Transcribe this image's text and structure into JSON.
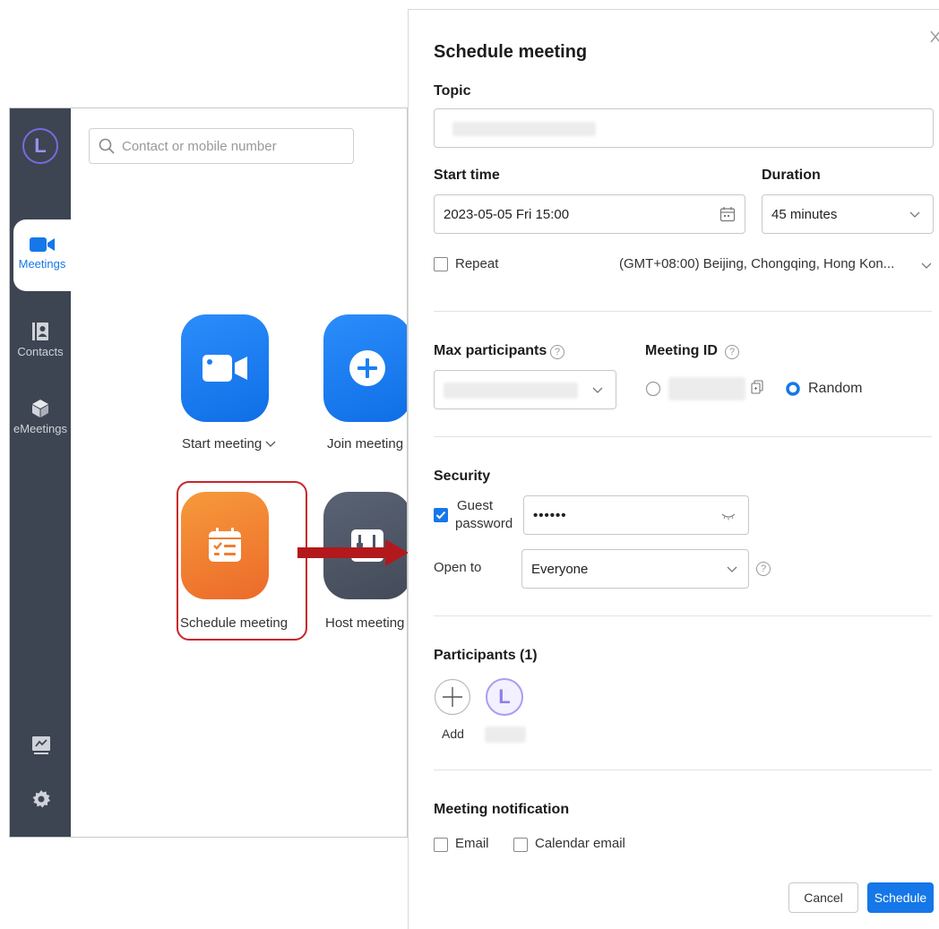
{
  "sidebar": {
    "avatar_initial": "L",
    "items": [
      {
        "label": "Meetings",
        "icon": "video-camera-icon"
      },
      {
        "label": "Contacts",
        "icon": "contact-card-icon"
      },
      {
        "label": "eMeetings",
        "icon": "cube-icon"
      }
    ],
    "bottom_icons": [
      "whiteboard-icon",
      "gear-icon"
    ]
  },
  "search": {
    "placeholder": "Contact or mobile number"
  },
  "tiles": [
    {
      "label": "Start meeting",
      "icon": "video-camera-icon",
      "color": "#1a7ef5"
    },
    {
      "label": "Join meeting",
      "icon": "plus-icon",
      "color": "#1a7ef5"
    },
    {
      "label": "Schedule meeting",
      "icon": "calendar-checklist-icon",
      "color": "#f07e30"
    },
    {
      "label": "Host meeting",
      "icon": "host-icon",
      "color": "#4c5565"
    }
  ],
  "dialog": {
    "title": "Schedule meeting",
    "close_icon": "close-icon",
    "topic": {
      "label": "Topic",
      "value": ""
    },
    "start_time": {
      "label": "Start time",
      "value": "2023-05-05 Fri 15:00"
    },
    "duration": {
      "label": "Duration",
      "value": "45 minutes"
    },
    "repeat": {
      "label": "Repeat",
      "checked": false
    },
    "timezone": "(GMT+08:00) Beijing, Chongqing, Hong Kon...",
    "max_participants": {
      "label": "Max participants",
      "value": ""
    },
    "meeting_id": {
      "label": "Meeting ID",
      "random_label": "Random",
      "selected": "Random"
    },
    "security": {
      "title": "Security",
      "guest_password_label_line1": "Guest",
      "guest_password_label_line2": "password",
      "guest_password_checked": true,
      "password_value": "••••••",
      "open_to_label": "Open to",
      "open_to_value": "Everyone"
    },
    "participants": {
      "title": "Participants (1)",
      "add_label": "Add",
      "avatar_initial": "L"
    },
    "notification": {
      "title": "Meeting notification",
      "email_label": "Email",
      "calendar_email_label": "Calendar email"
    },
    "cancel_label": "Cancel",
    "schedule_label": "Schedule"
  },
  "colors": {
    "accent": "#1577e8",
    "sidebar_bg": "#3d4552",
    "highlight": "#c8262b"
  }
}
